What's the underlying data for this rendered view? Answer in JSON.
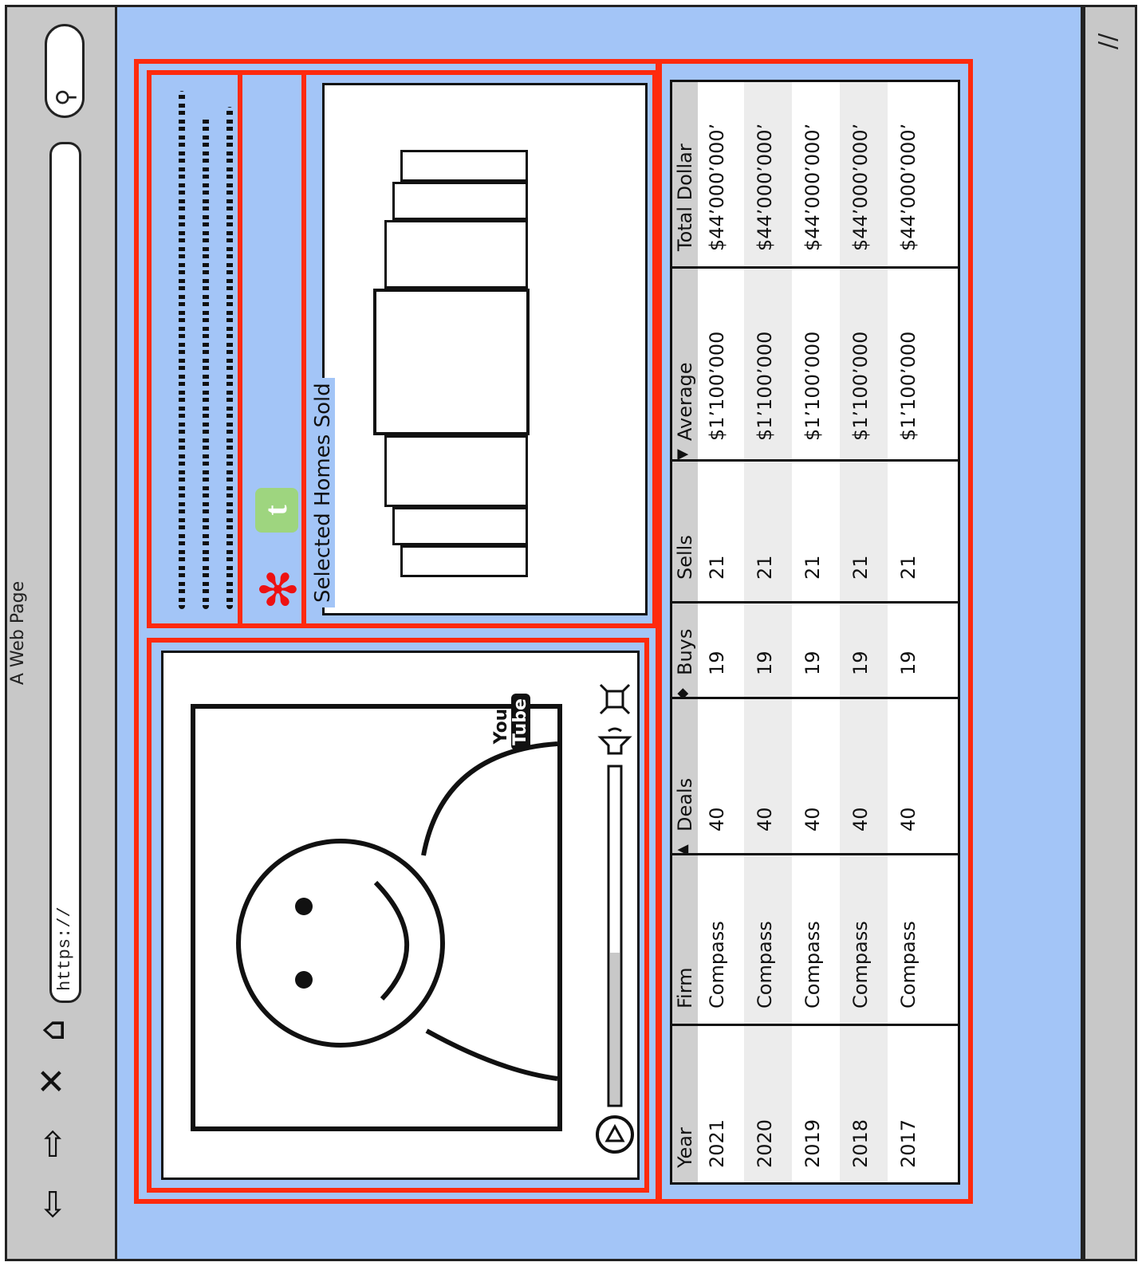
{
  "window": {
    "title": "A Web Page"
  },
  "toolbar": {
    "back_icon": "⇦",
    "forward_icon": "⇨",
    "stop_icon": "✕",
    "home_icon": "⌂",
    "url": "https://",
    "search_icon": "⚲",
    "resize_icon": "//"
  },
  "social": {
    "yelp_icon": "✻",
    "tumblr_icon": "t"
  },
  "coverflow": {
    "title": "Selected Homes Sold"
  },
  "video": {
    "logo_you": "You",
    "logo_tube": "Tube"
  },
  "table": {
    "columns": [
      "Year",
      "Firm",
      "Deals",
      "Buys",
      "Sells",
      "Average",
      "Total Dollar"
    ],
    "sort_icons": [
      "▲",
      "◆",
      "▼"
    ],
    "rows": [
      [
        "2021",
        "Compass",
        "40",
        "19",
        "21",
        "$1’100’000",
        "$44’000’000’"
      ],
      [
        "2020",
        "Compass",
        "40",
        "19",
        "21",
        "$1’100’000",
        "$44’000’000’"
      ],
      [
        "2019",
        "Compass",
        "40",
        "19",
        "21",
        "$1’100’000",
        "$44’000’000’"
      ],
      [
        "2018",
        "Compass",
        "40",
        "19",
        "21",
        "$1’100’000",
        "$44’000’000’"
      ],
      [
        "2017",
        "Compass",
        "40",
        "19",
        "21",
        "$1’100’000",
        "$44’000’000’"
      ]
    ]
  }
}
